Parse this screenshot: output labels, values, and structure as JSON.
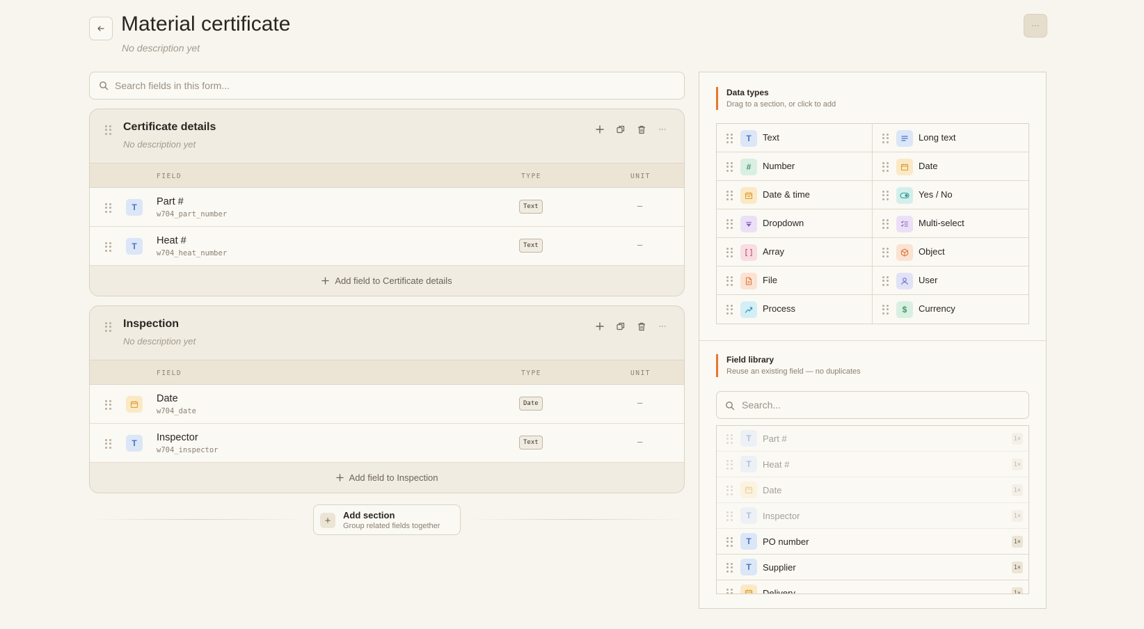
{
  "header": {
    "title": "Material certificate",
    "description": "No description yet"
  },
  "search": {
    "placeholder": "Search fields in this form..."
  },
  "table_headers": {
    "field": "FIELD",
    "type": "TYPE",
    "unit": "UNIT"
  },
  "sections": [
    {
      "title": "Certificate details",
      "description": "No description yet",
      "fields": [
        {
          "name": "Part #",
          "key": "w704_part_number",
          "type": "Text",
          "unit": "–",
          "icon": "text-icon"
        },
        {
          "name": "Heat #",
          "key": "w704_heat_number",
          "type": "Text",
          "unit": "–",
          "icon": "text-icon"
        }
      ],
      "add_label": "Add field to Certificate details"
    },
    {
      "title": "Inspection",
      "description": "No description yet",
      "fields": [
        {
          "name": "Date",
          "key": "w704_date",
          "type": "Date",
          "unit": "–",
          "icon": "calendar-icon"
        },
        {
          "name": "Inspector",
          "key": "w704_inspector",
          "type": "Text",
          "unit": "–",
          "icon": "text-icon"
        }
      ],
      "add_label": "Add field to Inspection"
    }
  ],
  "add_section": {
    "title": "Add section",
    "subtitle": "Group related fields together"
  },
  "data_types": {
    "title": "Data types",
    "subtitle": "Drag to a section, or click to add",
    "items": [
      {
        "label": "Text",
        "icon": "text-icon"
      },
      {
        "label": "Long text",
        "icon": "long-text-icon"
      },
      {
        "label": "Number",
        "icon": "hash-icon"
      },
      {
        "label": "Date",
        "icon": "calendar-icon"
      },
      {
        "label": "Date & time",
        "icon": "calendar-clock-icon"
      },
      {
        "label": "Yes / No",
        "icon": "toggle-icon"
      },
      {
        "label": "Dropdown",
        "icon": "dropdown-icon"
      },
      {
        "label": "Multi-select",
        "icon": "checklist-icon"
      },
      {
        "label": "Array",
        "icon": "brackets-icon"
      },
      {
        "label": "Object",
        "icon": "cube-icon"
      },
      {
        "label": "File",
        "icon": "file-icon"
      },
      {
        "label": "User",
        "icon": "user-icon"
      },
      {
        "label": "Process",
        "icon": "process-icon"
      },
      {
        "label": "Currency",
        "icon": "dollar-icon"
      }
    ]
  },
  "field_library": {
    "title": "Field library",
    "subtitle": "Reuse an existing field — no duplicates",
    "search_placeholder": "Search...",
    "items": [
      {
        "label": "Part #",
        "count": "1×",
        "used": true
      },
      {
        "label": "Heat #",
        "count": "1×",
        "used": true
      },
      {
        "label": "Date",
        "count": "1×",
        "used": true
      },
      {
        "label": "Inspector",
        "count": "1×",
        "used": true
      },
      {
        "label": "PO number",
        "count": "1×",
        "used": false
      },
      {
        "label": "Supplier",
        "count": "1×",
        "used": false
      },
      {
        "label": "Delivery",
        "count": "1×",
        "used": false
      }
    ]
  },
  "colors": {
    "accent": "#e8772e",
    "background": "#f8f5ee",
    "text_blue": "#4a74c9"
  }
}
